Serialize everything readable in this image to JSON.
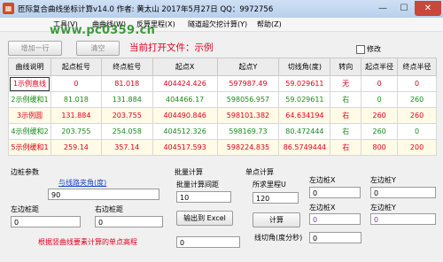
{
  "window": {
    "title": "匝际复合曲线坐标计算v14.0   作者: 黄太山  2017年5月27日  QQ：9972756",
    "min_glyph": "—",
    "max_glyph": "☐",
    "close_glyph": "✕"
  },
  "menu": [
    "工具(V)",
    "曲曲线(W)",
    "反算里程(X)",
    "隧道超欠挖计算(Y)",
    "帮助(Z)"
  ],
  "watermark": "www.pc0359.cn",
  "toolbar": {
    "add_row": "增加一行",
    "clear": "清空",
    "current_file": "当前打开文件：示例",
    "modify_checkbox": "修改"
  },
  "table": {
    "headers": [
      "曲线说明",
      "起点桩号",
      "终点桩号",
      "起点X",
      "起点Y",
      "切线角(度)",
      "转向",
      "起点半径",
      "终点半径"
    ],
    "rows": [
      {
        "cells": [
          "1示例直线",
          "0",
          "81.018",
          "404424.426",
          "597987.49",
          "59.029611",
          "无",
          "0",
          "0"
        ],
        "color": "#e0001b"
      },
      {
        "cells": [
          "2示例缓和1",
          "81.018",
          "131.884",
          "404466.17",
          "598056.957",
          "59.029611",
          "右",
          "0",
          "260"
        ],
        "color": "#1b8a1b"
      },
      {
        "cells": [
          "3示例圆",
          "131.884",
          "203.755",
          "404490.846",
          "598101.382",
          "64.634194",
          "右",
          "260",
          "260"
        ],
        "color": "#e0001b"
      },
      {
        "cells": [
          "4示例缓和2",
          "203.755",
          "254.058",
          "404512.326",
          "598169.73",
          "80.472444",
          "右",
          "260",
          "0"
        ],
        "color": "#1b8a1b"
      },
      {
        "cells": [
          "5示例缓和1",
          "259.14",
          "357.14",
          "404517.593",
          "598224.835",
          "86.5749444",
          "右",
          "800",
          "200"
        ],
        "color": "#e0001b"
      }
    ]
  },
  "edge": {
    "section_label": "边桩参数",
    "angle_link": "与线路夹角(度)",
    "angle_value": "90",
    "left_label": "左边桩距",
    "left_value": "0",
    "right_label": "右边桩距",
    "right_value": "0",
    "elevation_label": "根据竖曲线要素计算的单点高程",
    "elevation_value": "0"
  },
  "batch": {
    "section_label": "批量计算",
    "interval_label": "批量计算间距",
    "interval_value": "10",
    "export_button": "输出到 Excel"
  },
  "single": {
    "section_label": "单点计算",
    "mileage_label": "所求里程U",
    "mileage_value": "120",
    "calc_button": "计算",
    "lx1_label": "左边桩X",
    "lx1_value": "0",
    "ly1_label": "左边桩Y",
    "ly1_value": "0",
    "lx2_label": "左边桩X",
    "lx2_value": "0",
    "ly2_label": "左边桩Y",
    "ly2_value": "0",
    "tangent_label": "线切角(度分秒)",
    "tangent_value": "0"
  },
  "colors": {
    "red": "#e0001b",
    "green": "#1b8a1b",
    "link": "#1a44c4",
    "purple": "#7a3fa0"
  }
}
